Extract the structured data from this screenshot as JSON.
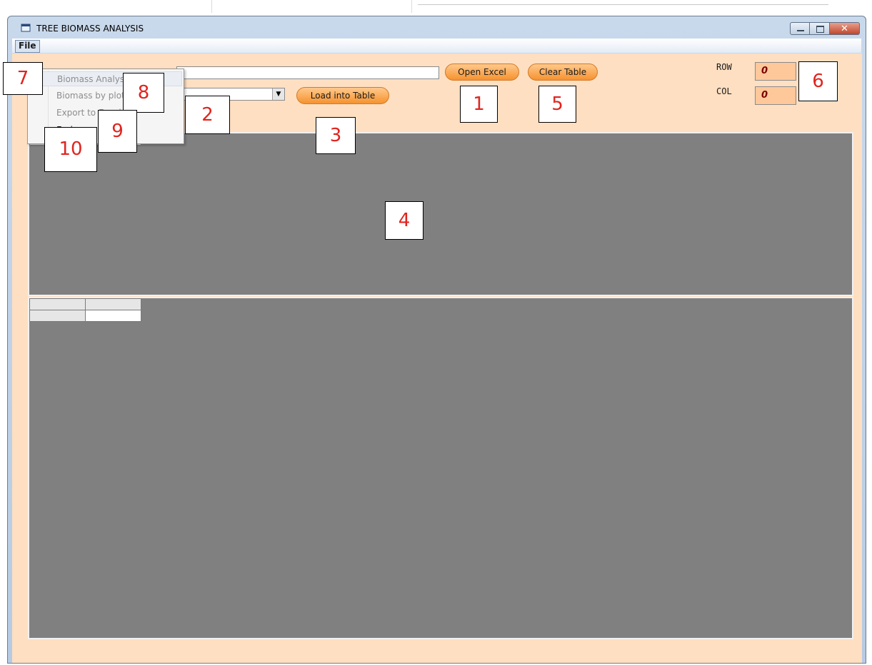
{
  "window": {
    "title": "TREE BIOMASS ANALYSIS"
  },
  "menubar": {
    "file_label": "File"
  },
  "file_menu": {
    "items": [
      {
        "label": "Biomass Analysis",
        "state": "disabled"
      },
      {
        "label": "Biomass by plot",
        "state": "disabled"
      },
      {
        "label": "Export to Excel",
        "state": "disabled"
      },
      {
        "label": "End",
        "state": "enabled"
      }
    ]
  },
  "toolbar": {
    "open_excel": "Open Excel",
    "clear_table": "Clear Table",
    "load_into_table": "Load into Table",
    "path_value": "",
    "sheet_value": ""
  },
  "counters": {
    "row_label": "ROW",
    "row_value": "0",
    "col_label": "COL",
    "col_value": "0"
  },
  "callouts": [
    "1",
    "2",
    "3",
    "4",
    "5",
    "6",
    "7",
    "8",
    "9",
    "10"
  ],
  "colors": {
    "client_bg": "#fedfc1",
    "button_orange": "#f6922f",
    "grid_bg": "#808080",
    "callout_text": "#e0241f"
  },
  "icons": {
    "app": "window-app-icon",
    "combo": "chevron-down-icon",
    "minimize": "minimize-icon",
    "maximize": "maximize-icon",
    "close": "close-icon"
  }
}
